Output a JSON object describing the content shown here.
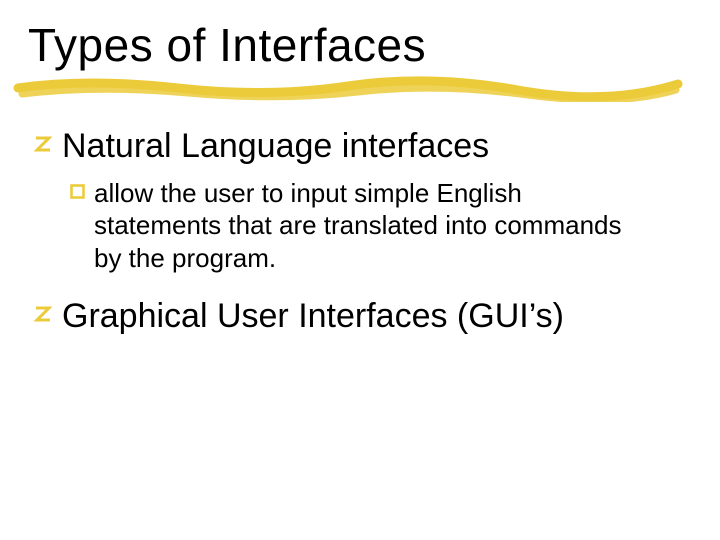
{
  "title": "Types of Interfaces",
  "colors": {
    "bullet": "#ECCB3B",
    "underline": "#ECCB3B"
  },
  "items": [
    {
      "text": "Natural Language interfaces",
      "children": [
        {
          "text": "allow the user to input simple English statements that are translated into commands by the program."
        }
      ]
    },
    {
      "text": "Graphical User Interfaces (GUI’s)",
      "children": []
    }
  ]
}
